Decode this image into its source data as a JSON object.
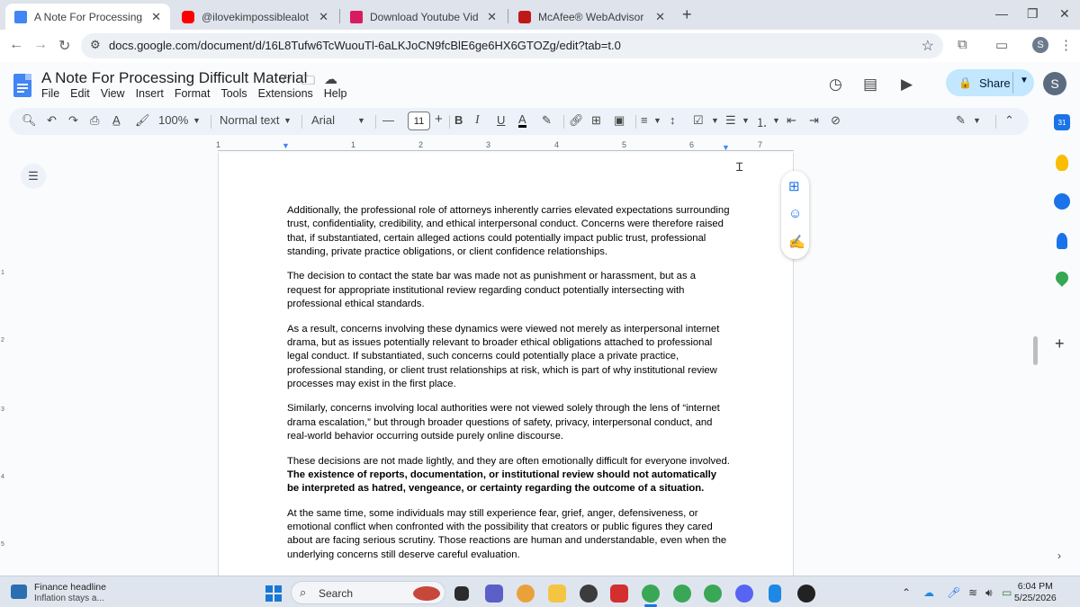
{
  "browser": {
    "tabs": [
      {
        "title": "A Note For Processing Difficult",
        "active": true
      },
      {
        "title": "@ilovekimpossiblealot \"SAFETY",
        "active": false
      },
      {
        "title": "Download Youtube Videos to M",
        "active": false
      },
      {
        "title": "McAfee® WebAdvisor - Websit",
        "active": false
      }
    ],
    "url": "docs.google.com/document/d/16L8Tufw6TcWuouTl-6aLKJoCN9fcBlE6ge6HX6GTOZg/edit?tab=t.0",
    "profile_initial": "S"
  },
  "docs": {
    "title": "A Note For Processing Difficult Material",
    "menus": [
      "File",
      "Edit",
      "View",
      "Insert",
      "Format",
      "Tools",
      "Extensions",
      "Help"
    ],
    "share_label": "Share",
    "avatar_initial": "S"
  },
  "toolbar": {
    "zoom": "100%",
    "style": "Normal text",
    "font": "Arial",
    "font_size": "11"
  },
  "ruler": {
    "ticks": [
      "1",
      "1",
      "2",
      "3",
      "4",
      "5",
      "6",
      "7"
    ]
  },
  "document": {
    "paragraphs": [
      {
        "text": "Additionally, the professional role of attorneys inherently carries elevated expectations surrounding trust, confidentiality, credibility, and ethical interpersonal conduct. Concerns were therefore raised that, if substantiated, certain alleged actions could potentially impact public trust, professional standing, private practice obligations, or client confidence relationships."
      },
      {
        "text": "The decision to contact the state bar was made not as punishment or harassment, but as a request for appropriate institutional review regarding conduct potentially intersecting with professional ethical standards."
      },
      {
        "text": "As a result, concerns involving these dynamics were viewed not merely as interpersonal internet drama, but as issues potentially relevant to broader ethical obligations attached to professional legal conduct. If substantiated, such concerns could potentially place a private practice, professional standing, or client trust relationships at risk, which is part of why institutional review processes may exist in the first place."
      },
      {
        "text": "Similarly, concerns involving local authorities were not viewed solely through the lens of “internet drama escalation,” but through broader questions of safety, privacy, interpersonal conduct, and real-world behavior occurring outside purely online discourse."
      },
      {
        "text": "These decisions are not made lightly, and they are often emotionally difficult for everyone involved. ",
        "bold": "The existence of reports, documentation, or institutional review should not automatically be interpreted as hatred, vengeance, or certainty regarding the outcome of a situation."
      },
      {
        "text": "At the same time, some individuals may still experience fear, grief, anger, defensiveness, or emotional conflict when confronted with the possibility that creators or public figures they cared about are facing serious scrutiny. Those reactions are human and understandable, even when the underlying concerns still deserve careful evaluation."
      }
    ]
  },
  "taskbar": {
    "news_headline": "Finance headline",
    "news_sub": "Inflation stays a...",
    "search_label": "Search",
    "time": "6:04 PM",
    "date": "5/25/2026"
  },
  "colors": {
    "accent": "#1a73e8",
    "share_bg": "#c2e7ff",
    "toolbar_bg": "#edf2fa"
  }
}
